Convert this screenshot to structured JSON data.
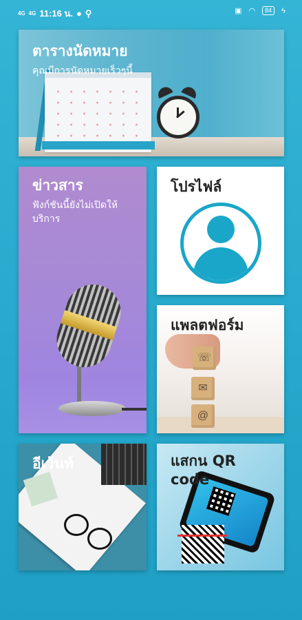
{
  "status_bar": {
    "signal_label": "4G",
    "signal2_label": "4G",
    "time": "11:16 น.",
    "battery": "84"
  },
  "tiles": {
    "appointment": {
      "title": "ตารางนัดหมาย",
      "subtitle": "คุณมีการนัดหมายเร็วๆนี้"
    },
    "news": {
      "title": "ข่าวสาร",
      "subtitle": "ฟังก์ชันนี้ยังไม่เปิดให้บริการ"
    },
    "profile": {
      "title": "โปรไฟล์"
    },
    "platform": {
      "title": "แพลตฟอร์ม"
    },
    "event": {
      "title": "อีเว้นท์"
    },
    "qr": {
      "title": "แสกน QR code"
    }
  },
  "colors": {
    "background": "#29acd0",
    "accent": "#1aa6c9"
  }
}
